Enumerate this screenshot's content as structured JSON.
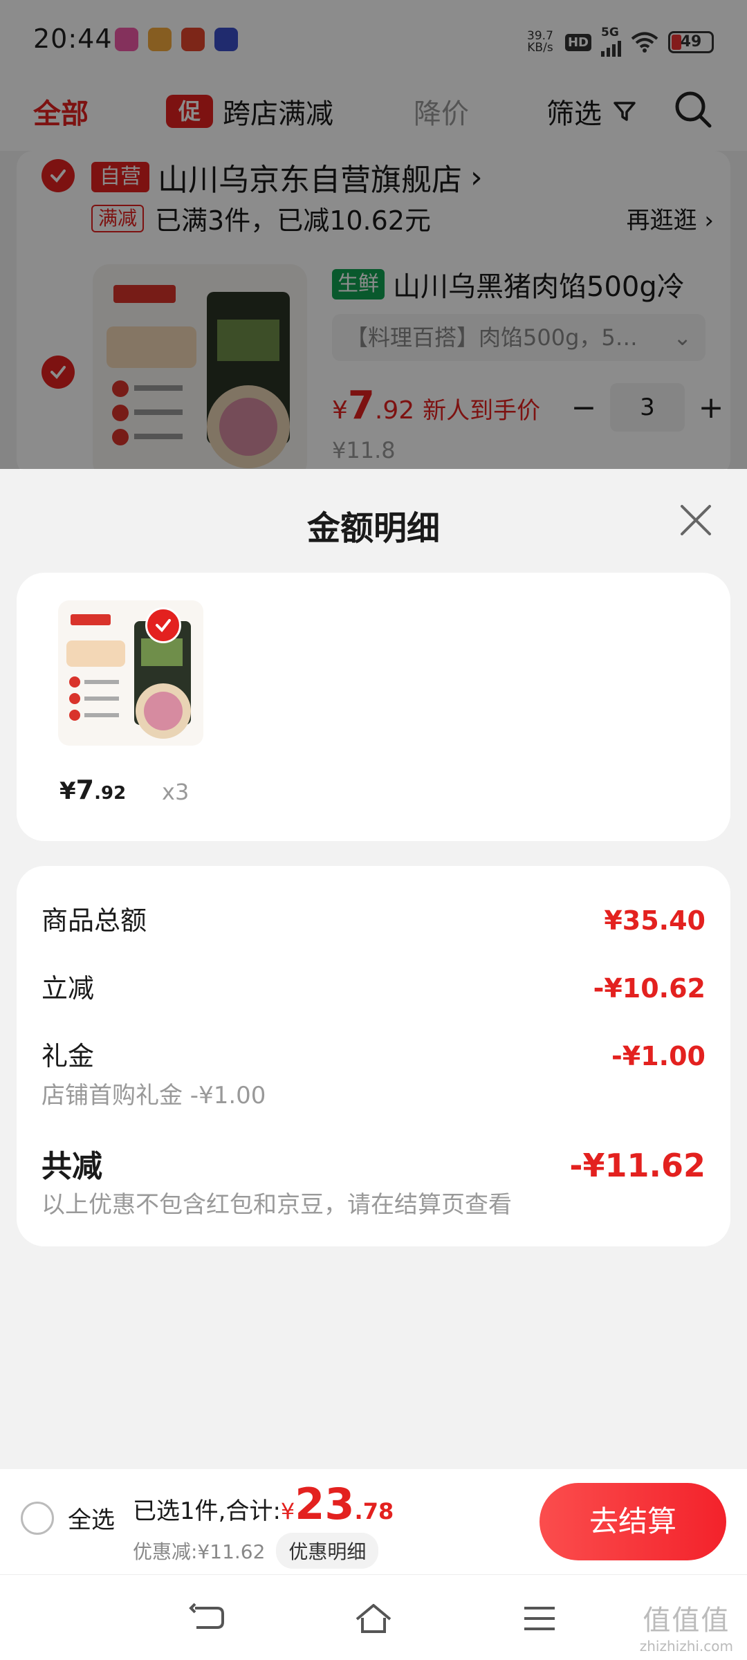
{
  "status_bar": {
    "time": "20:44",
    "net_speed_value": "39.7",
    "net_speed_unit": "KB/s",
    "hd_label": "HD",
    "network": "5G",
    "battery": "49"
  },
  "filter_bar": {
    "tab_all": "全部",
    "promo_badge": "促",
    "promo_label": "跨店满减",
    "price_drop": "降价",
    "filter": "筛选"
  },
  "cart": {
    "shop_tag": "自营",
    "shop_name": "山川乌京东自营旗舰店",
    "shop_chevron": "›",
    "promo_tag": "满减",
    "promo_text": "已满3件，已减10.62元",
    "promo_more": "再逛逛 ›",
    "item": {
      "tag": "生鲜",
      "name": "山川乌黑猪肉馅500g冷",
      "spec": "【料理百搭】肉馅500g，5…",
      "price_symbol": "¥",
      "price_int": "7",
      "price_dec": ".92",
      "price_note": "新人到手价",
      "minus": "−",
      "qty": "3",
      "plus": "+",
      "original_price": "¥11.8"
    }
  },
  "sheet": {
    "title": "金额明细",
    "product": {
      "price_symbol": "¥",
      "price_int": "7",
      "price_dec": ".92",
      "count": "x3"
    },
    "rows": {
      "total_label": "商品总额",
      "total_value": "¥35.40",
      "instant_label": "立减",
      "instant_value": "-¥10.62",
      "gift_label": "礼金",
      "gift_value": "-¥1.00",
      "gift_sub": "店铺首购礼金 -¥1.00",
      "saved_label": "共减",
      "saved_value": "-¥11.62",
      "saved_sub": "以上优惠不包含红包和京豆，请在结算页查看"
    }
  },
  "checkout": {
    "select_all": "全选",
    "selected_text": "已选1件,合计:",
    "total_symbol": "¥",
    "total_int": "23",
    "total_dec": ".78",
    "discount_text": "优惠减:¥11.62",
    "discount_detail": "优惠明细",
    "checkout_button": "去结算"
  },
  "watermark": {
    "line1": "值值值",
    "line2": "zhizhizhi.com"
  },
  "colors": {
    "accent": "#e3211f",
    "fresh": "#12a352"
  }
}
